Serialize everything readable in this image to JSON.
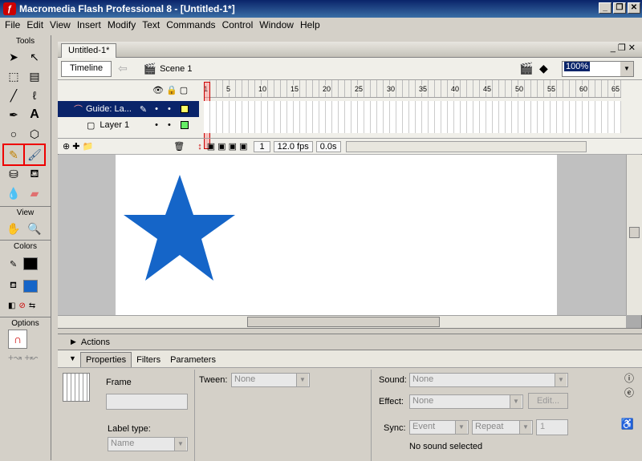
{
  "titlebar": {
    "title": "Macromedia Flash Professional 8 - [Untitled-1*]",
    "min": "_",
    "restore": "❐",
    "close": "✕"
  },
  "menu": [
    "File",
    "Edit",
    "View",
    "Insert",
    "Modify",
    "Text",
    "Commands",
    "Control",
    "Window",
    "Help"
  ],
  "tools": {
    "section_tools": "Tools",
    "section_view": "View",
    "section_colors": "Colors",
    "section_options": "Options"
  },
  "doc": {
    "tab": "Untitled-1*",
    "timeline_btn": "Timeline",
    "scene": "Scene 1",
    "zoom": "100%"
  },
  "timeline": {
    "layers": [
      {
        "name": "Guide: La...",
        "selected": true,
        "color": "#ffff66"
      },
      {
        "name": "Layer 1",
        "selected": false,
        "color": "#66ee66"
      }
    ],
    "frame_numbers": [
      "1",
      "5",
      "10",
      "15",
      "20",
      "25",
      "30",
      "35",
      "40",
      "45",
      "50",
      "55",
      "60",
      "65"
    ],
    "status": {
      "frame": "1",
      "fps": "12.0 fps",
      "time": "0.0s"
    }
  },
  "stage": {
    "star_color": "#1565c8"
  },
  "panels": {
    "actions": "Actions",
    "tabs": [
      "Properties",
      "Filters",
      "Parameters"
    ]
  },
  "props": {
    "frame_label": "Frame",
    "tween_label": "Tween:",
    "tween_value": "None",
    "label_type_label": "Label type:",
    "label_type_value": "Name",
    "sound_label": "Sound:",
    "sound_value": "None",
    "effect_label": "Effect:",
    "effect_value": "None",
    "edit_btn": "Edit...",
    "sync_label": "Sync:",
    "sync_value": "Event",
    "repeat_value": "Repeat",
    "repeat_count": "1",
    "no_sound": "No sound selected"
  }
}
